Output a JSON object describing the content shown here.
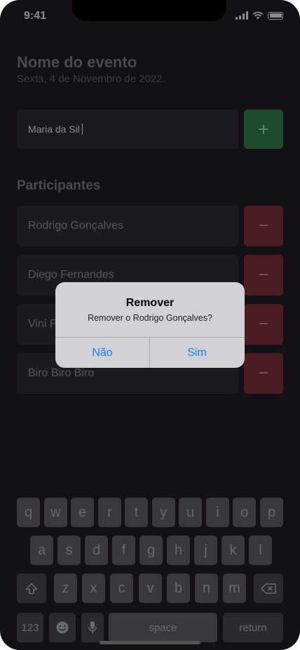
{
  "status_bar": {
    "time": "9:41"
  },
  "event": {
    "name": "Nome do evento",
    "date": "Sexta, 4 de Novembro de 2022."
  },
  "input": {
    "value": "Maria da Sil"
  },
  "add_button": {
    "label": "+"
  },
  "section": {
    "title": "Participantes"
  },
  "participants": [
    {
      "name": "Rodrigo Gonçalves"
    },
    {
      "name": "Diego Fernandes"
    },
    {
      "name": "Vini F"
    },
    {
      "name": "Biro Biro Biro"
    }
  ],
  "remove_button": {
    "label": "−"
  },
  "alert": {
    "title": "Remover",
    "message": "Remover o Rodrigo Gonçalves?",
    "cancel_label": "Não",
    "confirm_label": "Sim"
  },
  "keyboard": {
    "row1": [
      "q",
      "w",
      "e",
      "r",
      "t",
      "y",
      "u",
      "i",
      "o",
      "p"
    ],
    "row2": [
      "a",
      "s",
      "d",
      "f",
      "g",
      "h",
      "j",
      "k",
      "l"
    ],
    "row3": [
      "z",
      "x",
      "c",
      "v",
      "b",
      "n",
      "m"
    ],
    "numbers_label": "123",
    "space_label": "space",
    "return_label": "return"
  }
}
